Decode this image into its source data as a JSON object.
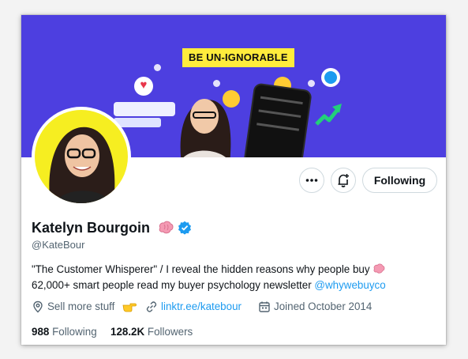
{
  "banner": {
    "tagline": "BE UN-IGNORABLE",
    "background_color": "#4d3fe0",
    "tagline_color": "#ffec3c"
  },
  "profile": {
    "name": "Katelyn Bourgoin",
    "name_emoji": "brain-emoji",
    "verified": true,
    "handle": "@KateBour"
  },
  "actions": {
    "more_icon": "more-icon",
    "notify_icon": "notification-bell-plus-icon",
    "following_label": "Following"
  },
  "bio": {
    "line1": "\"The Customer Whisperer\" / I reveal the hidden reasons why people buy",
    "line1_emoji": "brain-emoji",
    "line2": "62,000+ smart people read my buyer psychology newsletter ",
    "mention": "@whywebuyco"
  },
  "meta": {
    "location": "Sell more stuff",
    "location_emoji": "pointing-hand-emoji",
    "link": "linktr.ee/katebour",
    "joined": "Joined October 2014"
  },
  "stats": {
    "following_count": "988",
    "following_label": "Following",
    "followers_count": "128.2K",
    "followers_label": "Followers"
  },
  "colors": {
    "accent": "#1d9bf0",
    "text": "#0f1419",
    "secondary_text": "#536471",
    "border": "#cfd9de",
    "avatar_bg": "#f6ee21"
  }
}
